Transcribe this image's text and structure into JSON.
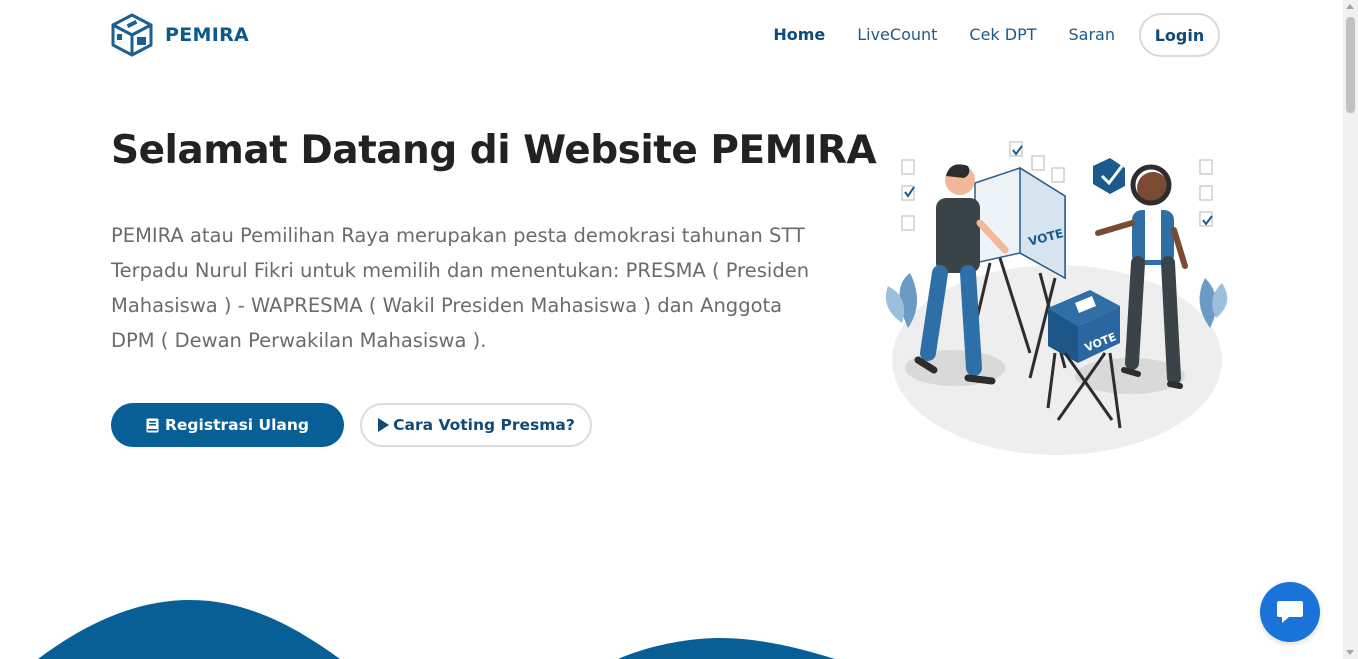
{
  "brand": {
    "name": "PEMIRA",
    "logo_icon": "ballot-box-logo-icon"
  },
  "nav": {
    "items": [
      {
        "label": "Home",
        "active": true
      },
      {
        "label": "LiveCount",
        "active": false
      },
      {
        "label": "Cek DPT",
        "active": false
      },
      {
        "label": "Saran",
        "active": false
      }
    ],
    "login_label": "Login"
  },
  "hero": {
    "title": "Selamat Datang di Website PEMIRA",
    "description": "PEMIRA atau Pemilihan Raya merupakan pesta demokrasi tahunan STT Terpadu Nurul Fikri untuk memilih dan menentukan: PRESMA ( Presiden Mahasiswa ) - WAPRESMA ( Wakil Presiden Mahasiswa ) dan Anggota DPM ( Dewan Perwakilan Mahasiswa ).",
    "primary_button": {
      "label": "Registrasi Ulang",
      "icon": "book-icon"
    },
    "secondary_button": {
      "label": "Cara Voting Presma?",
      "icon": "play-icon"
    }
  },
  "illustration": {
    "icon": "voting-illustration",
    "booth_text": "VOTE",
    "box_text": "VOTE"
  },
  "chat": {
    "icon": "chat-bubble-icon"
  },
  "colors": {
    "primary": "#075f96",
    "brand_text": "#0b5a8c",
    "chat": "#1a73d9",
    "muted_text": "#6b6b6b"
  }
}
